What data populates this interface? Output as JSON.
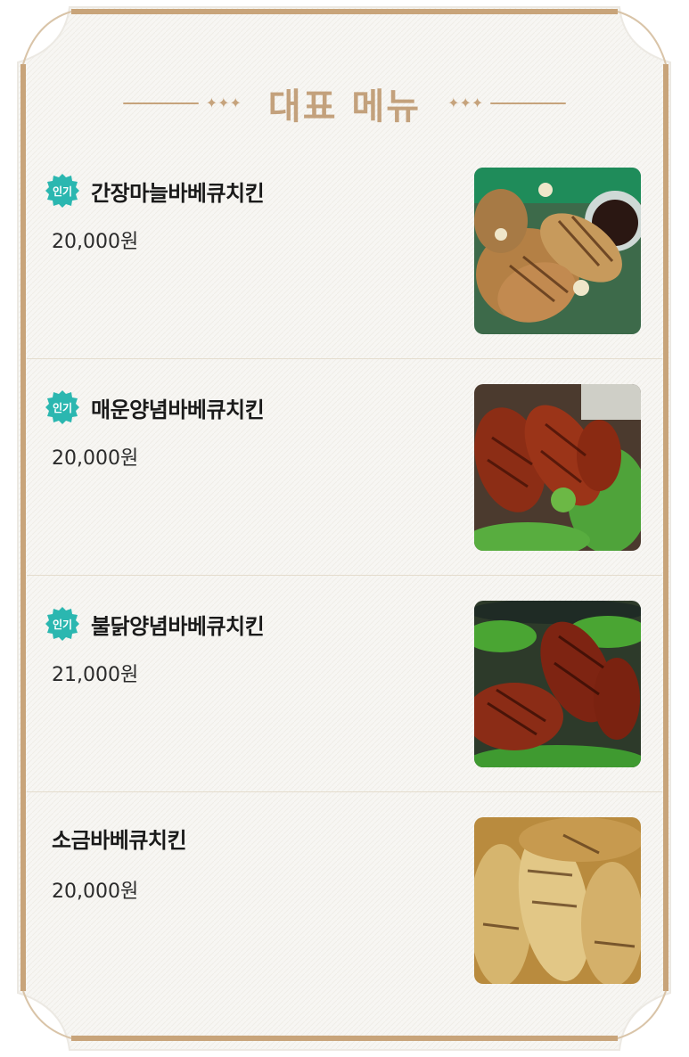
{
  "header": {
    "title": "대표 메뉴"
  },
  "menu": {
    "items": [
      {
        "badge": "인기",
        "name": "간장마늘바베큐치킨",
        "price": "20,000원",
        "photo_icon": "soy-garlic-chicken-photo"
      },
      {
        "badge": "인기",
        "name": "매운양념바베큐치킨",
        "price": "20,000원",
        "photo_icon": "spicy-chicken-photo"
      },
      {
        "badge": "인기",
        "name": "불닭양념바베큐치킨",
        "price": "21,000원",
        "photo_icon": "fire-chicken-photo"
      },
      {
        "name": "소금바베큐치킨",
        "price": "20,000원",
        "photo_icon": "salt-chicken-photo"
      }
    ]
  },
  "colors": {
    "accent": "#c3a17c",
    "badge": "#2bb7b0",
    "frame": "#c8a47a",
    "paper": "#f7f6f3"
  }
}
